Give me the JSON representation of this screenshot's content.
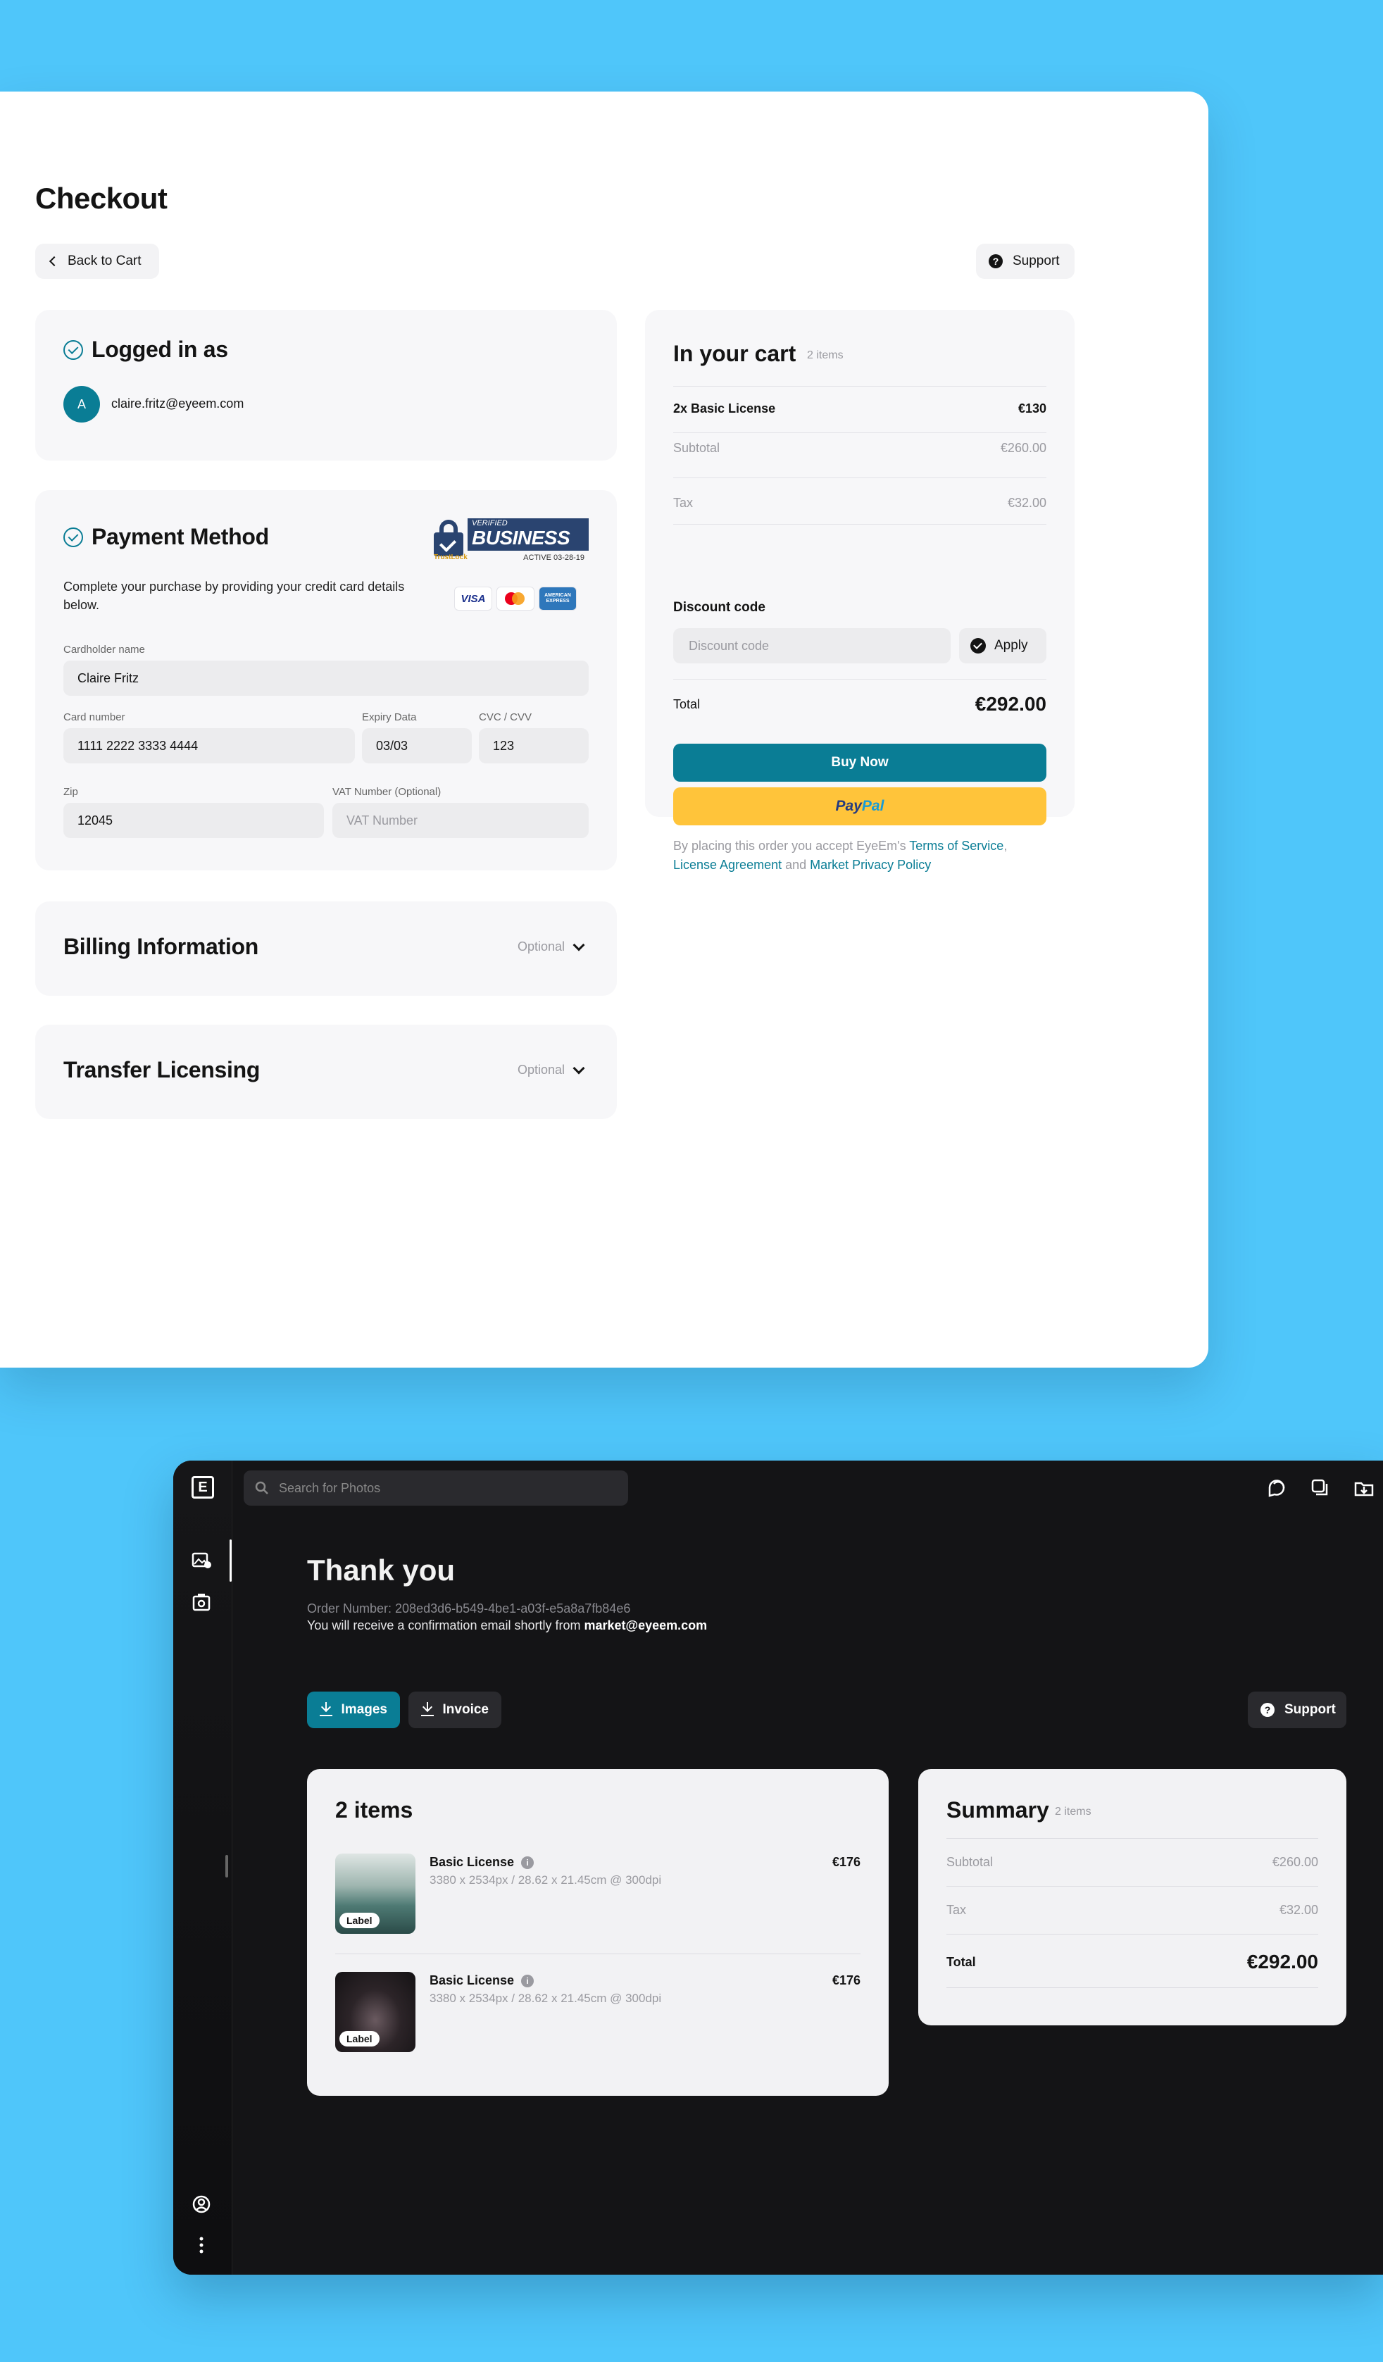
{
  "checkout": {
    "title": "Checkout",
    "back_label": "Back to Cart",
    "support_label": "Support",
    "login": {
      "title": "Logged in as",
      "avatar_initial": "A",
      "email": "claire.fritz@eyeem.com"
    },
    "payment": {
      "title": "Payment Method",
      "description": "Complete your purchase by providing your credit card details below.",
      "badge": {
        "verified": "VERIFIED",
        "business": "BUSINESS",
        "trust": "TrustLock",
        "active": "ACTIVE 03-28-19"
      },
      "card_brands": [
        "VISA",
        "Mastercard",
        "AMERICAN EXPRESS"
      ],
      "cardholder_label": "Cardholder name",
      "cardholder_value": "Claire Fritz",
      "card_number_label": "Card number",
      "card_number_value": "1111 2222 3333 4444",
      "expiry_label": "Expiry Data",
      "expiry_value": "03/03",
      "cvc_label": "CVC / CVV",
      "cvc_value": "123",
      "zip_label": "Zip",
      "zip_value": "12045",
      "vat_label": "VAT Number (Optional)",
      "vat_placeholder": "VAT Number"
    },
    "billing": {
      "title": "Billing Information",
      "optional": "Optional"
    },
    "transfer": {
      "title": "Transfer Licensing",
      "optional": "Optional"
    },
    "cart": {
      "title": "In your cart",
      "count": "2 items",
      "item_label": "2x Basic License",
      "item_price": "€130",
      "subtotal_label": "Subtotal",
      "subtotal_value": "€260.00",
      "tax_label": "Tax",
      "tax_value": "€32.00",
      "discount_label": "Discount code",
      "discount_placeholder": "Discount code",
      "apply_label": "Apply",
      "total_label": "Total",
      "total_value": "€292.00",
      "buy_label": "Buy Now",
      "paypal_1": "Pay",
      "paypal_2": "Pal",
      "legal_pre": "By placing this order you accept EyeEm's ",
      "terms_link": "Terms of Service",
      "comma": ",",
      "license_link": "License Agreement",
      "and": " and ",
      "privacy_link": "Market Privacy Policy"
    }
  },
  "app": {
    "logo": "E",
    "search_placeholder": "Search for Photos",
    "thank_you": {
      "title": "Thank you",
      "order": "Order Number: 208ed3d6-b549-4be1-a03f-e5a8a7fb84e6",
      "email_pre": "You will receive a confirmation email shortly from ",
      "email_addr": "market@eyeem.com"
    },
    "images_label": "Images",
    "invoice_label": "Invoice",
    "support_label": "Support",
    "items": {
      "title": "2 items",
      "list": [
        {
          "name": "Basic License",
          "spec": "3380 x 2534px / 28.62 x 21.45cm @ 300dpi",
          "price": "€176",
          "label": "Label"
        },
        {
          "name": "Basic License",
          "spec": "3380 x 2534px / 28.62 x 21.45cm @ 300dpi",
          "price": "€176",
          "label": "Label"
        }
      ]
    },
    "summary": {
      "title": "Summary",
      "count": "2 items",
      "subtotal_label": "Subtotal",
      "subtotal_value": "€260.00",
      "tax_label": "Tax",
      "tax_value": "€32.00",
      "total_label": "Total",
      "total_value": "€292.00"
    }
  },
  "colors": {
    "background": "#4fc6fa",
    "accent": "#0a7d95",
    "paypal": "#ffc43a",
    "dark": "#141416"
  }
}
